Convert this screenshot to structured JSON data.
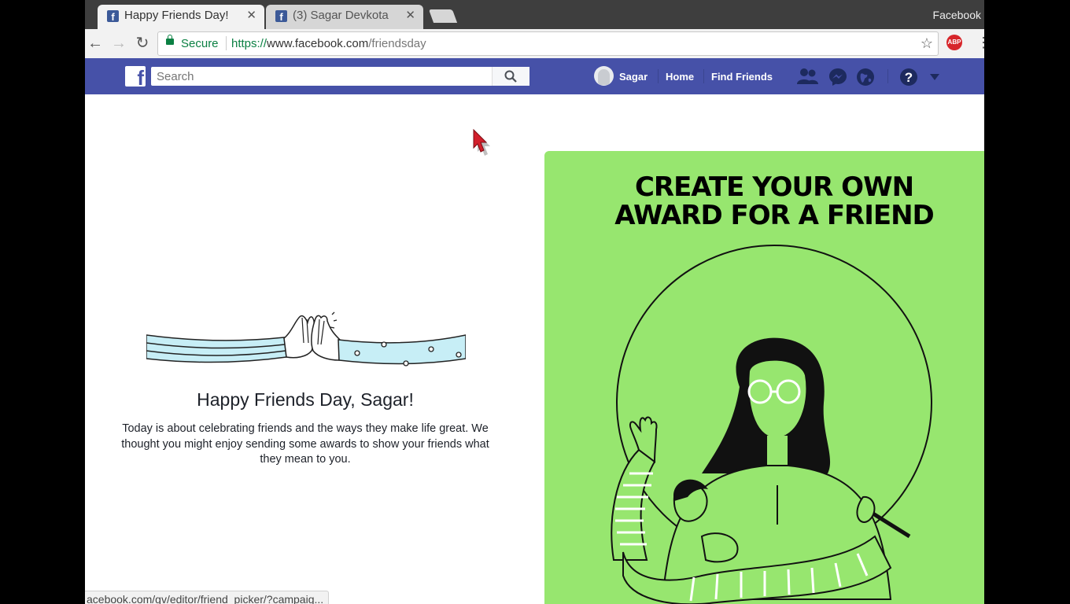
{
  "browser": {
    "tabs": [
      {
        "title": "Happy Friends Day!",
        "favicon": "facebook-favicon",
        "active": true
      },
      {
        "title": "(3) Sagar Devkota",
        "favicon": "facebook-favicon",
        "active": false
      }
    ],
    "window_title": "Facebook",
    "omnibox": {
      "secure_label": "Secure",
      "url_scheme": "https://",
      "url_host": "www.facebook.com",
      "url_path": "/friendsday"
    },
    "extension_label": "ABP",
    "status_url": "acebook.com/gv/editor/friend_picker/?campaig..."
  },
  "facebook_bar": {
    "logo": "f",
    "search_placeholder": "Search",
    "profile_name": "Sagar",
    "home_label": "Home",
    "find_friends_label": "Find Friends",
    "brand_color": "#4651a8"
  },
  "main": {
    "greeting": "Happy Friends Day, Sagar!",
    "message": "Today is about celebrating friends and the ways they make life great. We thought you might enjoy sending some awards to show your friends what they mean to you."
  },
  "award_card": {
    "heading_line1": "CREATE YOUR OWN",
    "heading_line2": "AWARD FOR A FRIEND",
    "background_color": "#97e66f"
  }
}
